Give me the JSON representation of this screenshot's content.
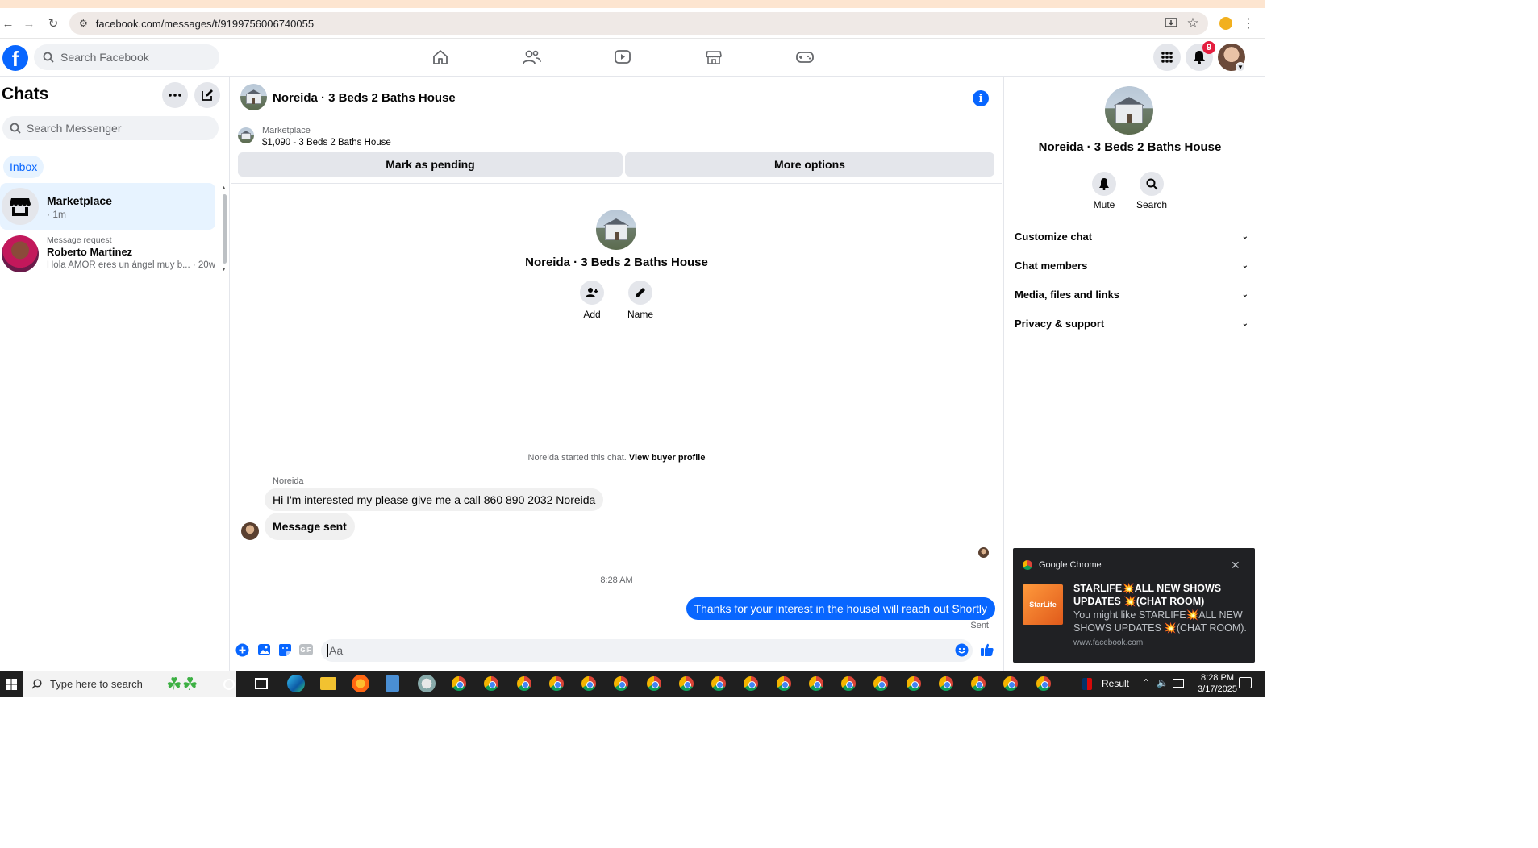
{
  "browser": {
    "url": "facebook.com/messages/t/9199756006740055"
  },
  "header": {
    "logo": "f",
    "search_placeholder": "Search Facebook",
    "notification_count": "9"
  },
  "sidebar": {
    "title": "Chats",
    "search_placeholder": "Search Messenger",
    "tab": "Inbox",
    "chats": [
      {
        "name": "Marketplace",
        "sub": "· 1m",
        "label": ""
      },
      {
        "name": "Roberto Martinez",
        "sub": "Hola AMOR eres un ángel muy b... · 20w",
        "label": "Message request"
      }
    ]
  },
  "conversation": {
    "title": "Noreida · 3 Beds 2 Baths House",
    "marketplace_label": "Marketplace",
    "listing": "$1,090 - 3 Beds 2 Baths House",
    "btn_pending": "Mark as pending",
    "btn_more": "More options",
    "intro_name": "Noreida · 3 Beds 2 Baths House",
    "intro_add": "Add",
    "intro_name_btn": "Name",
    "started_text": "Noreida started this chat.",
    "view_buyer": "View buyer profile",
    "sender": "Noreida",
    "messages_in": [
      "Hi I'm interested my please give me a call 860 890 2032 Noreida",
      "Message sent"
    ],
    "timestamp": "8:28 AM",
    "message_out": "Thanks for your interest in the housel will reach out Shortly",
    "status": "Sent",
    "composer_placeholder": "Aa"
  },
  "details": {
    "name": "Noreida · 3 Beds 2 Baths House",
    "mute": "Mute",
    "search": "Search",
    "sections": [
      "Customize chat",
      "Chat members",
      "Media, files and links",
      "Privacy & support"
    ]
  },
  "notification": {
    "app": "Google Chrome",
    "title": "STARLIFE💥ALL NEW SHOWS UPDATES 💥(CHAT ROOM)",
    "body": "You might like STARLIFE💥ALL NEW SHOWS UPDATES 💥(CHAT ROOM).",
    "source": "www.facebook.com",
    "thumb_text": "StarLife"
  },
  "taskbar": {
    "search_placeholder": "Type here to search",
    "result": "Result",
    "time": "8:28 PM",
    "date": "3/17/2025"
  },
  "colors": {
    "accent": "#0866ff",
    "bubble_in": "#f0f0f0"
  }
}
